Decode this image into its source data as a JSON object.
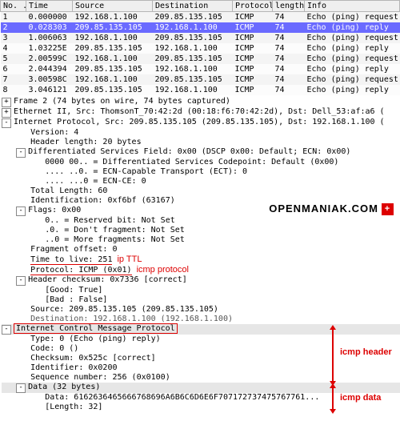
{
  "columns": [
    "No. .",
    "Time",
    "Source",
    "Destination",
    "Protocol",
    "length",
    "Info"
  ],
  "rows": [
    {
      "no": "1",
      "time": "0.000000",
      "src": "192.168.1.100",
      "dst": "209.85.135.105",
      "proto": "ICMP",
      "len": "74",
      "info": "Echo (ping) request"
    },
    {
      "no": "2",
      "time": "0.028303",
      "src": "209.85.135.105",
      "dst": "192.168.1.100",
      "proto": "ICMP",
      "len": "74",
      "info": "Echo (ping) reply"
    },
    {
      "no": "3",
      "time": "1.006063",
      "src": "192.168.1.100",
      "dst": "209.85.135.105",
      "proto": "ICMP",
      "len": "74",
      "info": "Echo (ping) request"
    },
    {
      "no": "4",
      "time": "1.03225E",
      "src": "209.85.135.105",
      "dst": "192.168.1.100",
      "proto": "ICMP",
      "len": "74",
      "info": "Echo (ping) reply"
    },
    {
      "no": "5",
      "time": "2.00599C",
      "src": "192.168.1.100",
      "dst": "209.85.135.105",
      "proto": "ICMP",
      "len": "74",
      "info": "Echo (ping) request"
    },
    {
      "no": "6",
      "time": "2.044394",
      "src": "209.85.135.105",
      "dst": "192.168.1.100",
      "proto": "ICMP",
      "len": "74",
      "info": "Echo (ping) reply"
    },
    {
      "no": "7",
      "time": "3.00598C",
      "src": "192.168.1.100",
      "dst": "209.85.135.105",
      "proto": "ICMP",
      "len": "74",
      "info": "Echo (ping) request"
    },
    {
      "no": "8",
      "time": "3.046121",
      "src": "209.85.135.105",
      "dst": "192.168.1.100",
      "proto": "ICMP",
      "len": "74",
      "info": "Echo (ping) reply"
    }
  ],
  "tree": {
    "frame": "Frame 2 (74 bytes on wire, 74 bytes captured)",
    "eth": "Ethernet II, Src: ThomsonT_70:42:2d (00:18:f6:70:42:2d), Dst: Dell_53:af:a6 (",
    "ip": "Internet Protocol, Src: 209.85.135.105 (209.85.135.105), Dst: 192.168.1.100 (",
    "ver": "Version: 4",
    "hlen": "Header length: 20 bytes",
    "dsf": "Differentiated Services Field: 0x00 (DSCP 0x00: Default; ECN: 0x00)",
    "dsf1": "0000 00.. = Differentiated Services Codepoint: Default (0x00)",
    "dsf2": ".... ..0. = ECN-Capable Transport (ECT): 0",
    "dsf3": ".... ...0 = ECN-CE: 0",
    "tlen": "Total Length: 60",
    "ident": "Identification: 0xf6bf (63167)",
    "flags": "Flags: 0x00",
    "fl1": "0.. = Reserved bit: Not Set",
    "fl2": ".0. = Don't fragment: Not Set",
    "fl3": "..0 = More fragments: Not Set",
    "frag": "Fragment offset: 0",
    "ttl": "Time to live: 251",
    "proto": "Protocol: ICMP (0x01)",
    "chk": "Header checksum: 0x7336 [correct]",
    "chk1": "[Good: True]",
    "chk2": "[Bad : False]",
    "srcip": "Source: 209.85.135.105 (209.85.135.105)",
    "dstip": "Destination: 192.168.1.100 (192.168.1.100)",
    "icmp": "Internet Control Message Protocol",
    "type": "Type: 0 (Echo (ping) reply)",
    "code": "Code: 0 ()",
    "ichk": "Checksum: 0x525c [correct]",
    "idr": "Identifier: 0x0200",
    "seq": "Sequence number: 256 (0x0100)",
    "data": "Data (32 bytes)",
    "dhex": "Data: 6162636465666768696A6B6C6D6E6F707172737475767761...",
    "dlen": "[Length: 32]"
  },
  "ann": {
    "ttl": "ip TTL",
    "proto": "icmp protocol",
    "hdr": "icmp header",
    "data": "icmp data",
    "wm": "OPENMANIAK.COM",
    "flag": "+"
  }
}
